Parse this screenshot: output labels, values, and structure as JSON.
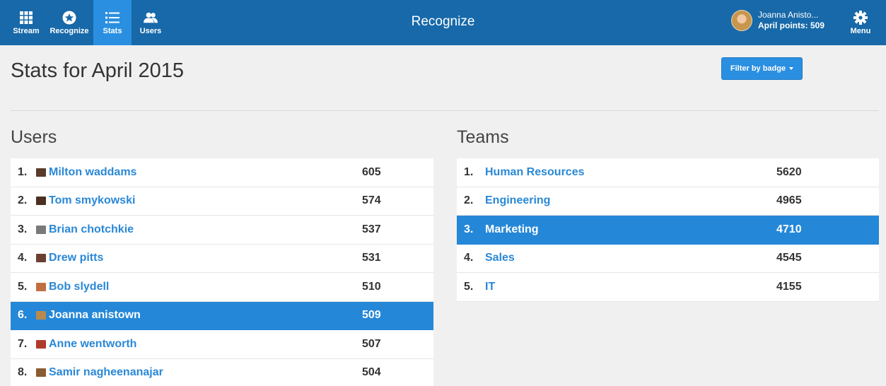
{
  "nav": {
    "items": [
      {
        "label": "Stream",
        "icon": "grid-icon"
      },
      {
        "label": "Recognize",
        "icon": "star-icon"
      },
      {
        "label": "Stats",
        "icon": "list-icon"
      },
      {
        "label": "Users",
        "icon": "users-icon"
      }
    ],
    "active": "Stats"
  },
  "header": {
    "title": "Recognize",
    "user_name": "Joanna Anisto...",
    "user_points": "April points: 509",
    "menu_label": "Menu"
  },
  "page": {
    "title": "Stats for April 2015",
    "filter_label": "Filter by badge"
  },
  "users": {
    "title": "Users",
    "rows": [
      {
        "rank": "1.",
        "name": "Milton waddams",
        "score": "605",
        "avatar_color": "#5a3a2a"
      },
      {
        "rank": "2.",
        "name": "Tom smykowski",
        "score": "574",
        "avatar_color": "#4a3020"
      },
      {
        "rank": "3.",
        "name": "Brian chotchkie",
        "score": "537",
        "avatar_color": "#7a7a7a"
      },
      {
        "rank": "4.",
        "name": "Drew pitts",
        "score": "531",
        "avatar_color": "#6a4030"
      },
      {
        "rank": "5.",
        "name": "Bob slydell",
        "score": "510",
        "avatar_color": "#c07040"
      },
      {
        "rank": "6.",
        "name": "Joanna anistown",
        "score": "509",
        "avatar_color": "#b88a50"
      },
      {
        "rank": "7.",
        "name": "Anne wentworth",
        "score": "507",
        "avatar_color": "#b03a2a"
      },
      {
        "rank": "8.",
        "name": "Samir nagheenanajar",
        "score": "504",
        "avatar_color": "#8a5a30"
      }
    ],
    "highlight_index": 5
  },
  "teams": {
    "title": "Teams",
    "rows": [
      {
        "rank": "1.",
        "name": "Human Resources",
        "score": "5620"
      },
      {
        "rank": "2.",
        "name": "Engineering",
        "score": "4965"
      },
      {
        "rank": "3.",
        "name": "Marketing",
        "score": "4710"
      },
      {
        "rank": "4.",
        "name": "Sales",
        "score": "4545"
      },
      {
        "rank": "5.",
        "name": "IT",
        "score": "4155"
      }
    ],
    "highlight_index": 2
  },
  "colors": {
    "header_bg": "#1769a9",
    "accent": "#2487d8",
    "link": "#2a88d6"
  }
}
